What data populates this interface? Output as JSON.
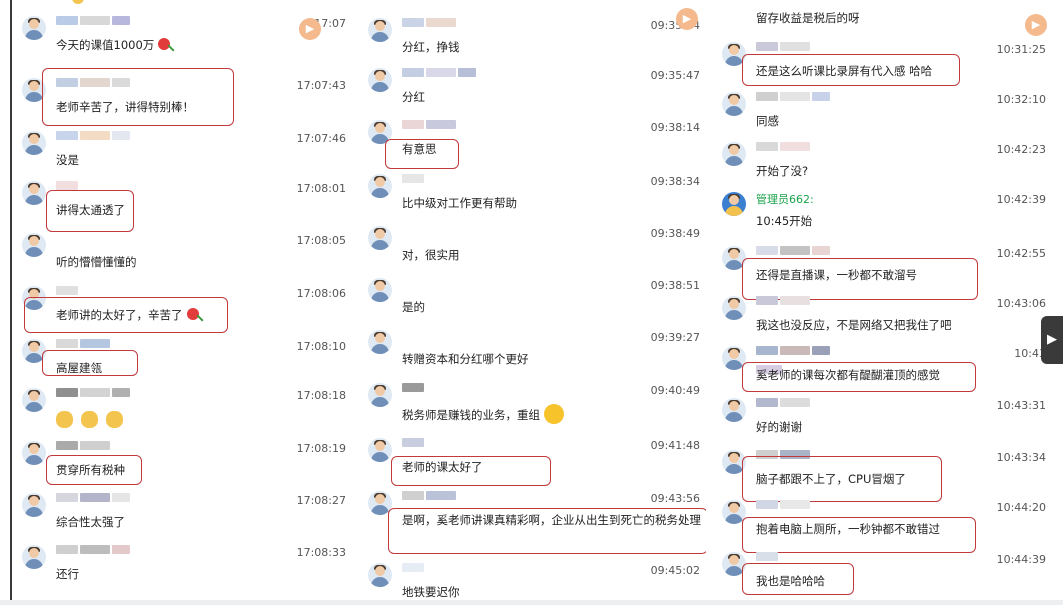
{
  "columns": [
    {
      "messages": [
        {
          "time": "17:07",
          "text": "今天的课值1000万",
          "emoji": "flower",
          "name_colors": [
            "#b9cbe6",
            "#d8d8d8",
            "#b7b7dd"
          ]
        },
        {
          "time": "17:07:43",
          "text": "老师辛苦了，讲得特别棒！",
          "boxed": true,
          "name_colors": [
            "#c2cfe3",
            "#e2d6cf",
            "#dadada"
          ]
        },
        {
          "time": "17:07:46",
          "text": "没是",
          "name_colors": [
            "#c8d4ec",
            "#f4dcc4",
            "#e3e8f0"
          ]
        },
        {
          "time": "17:08:01",
          "text": "讲得太通透了",
          "boxed": true,
          "name_colors": [
            "#f2dede"
          ]
        },
        {
          "time": "17:08:05",
          "text": "听的懵懵懂懂的",
          "name_colors": []
        },
        {
          "time": "17:08:06",
          "text": "老师讲的太好了，辛苦了",
          "emoji": "flower",
          "boxed": true,
          "name_colors": [
            "#e0e0e0"
          ]
        },
        {
          "time": "17:08:10",
          "text": "高屋建瓴",
          "boxed": true,
          "name_colors": [
            "#d9d9d9",
            "#b5c7e0"
          ]
        },
        {
          "time": "17:08:18",
          "text": "",
          "emoji": "claps",
          "name_colors": [
            "#8f8f8f",
            "#d3d3d3",
            "#b0b0b0"
          ]
        },
        {
          "time": "17:08:19",
          "text": "贯穿所有税种",
          "boxed": true,
          "name_colors": [
            "#aaaaaa",
            "#cfcfcf"
          ]
        },
        {
          "time": "17:08:27",
          "text": "综合性太强了",
          "name_colors": [
            "#d6d6de",
            "#b3b3c9",
            "#e5e5e5"
          ]
        },
        {
          "time": "17:08:33",
          "text": "还行",
          "name_colors": [
            "#cfcfcf",
            "#bdbdbd",
            "#e3c9c9"
          ]
        }
      ]
    },
    {
      "messages": [
        {
          "time": "09:35:44",
          "text": "分红，挣钱",
          "name_colors": [
            "#cbd3e6",
            "#e9d9cf"
          ]
        },
        {
          "time": "09:35:47",
          "text": "分红",
          "name_colors": [
            "#c4cee2",
            "#d8d8e8",
            "#b7bfd8"
          ]
        },
        {
          "time": "09:38:14",
          "text": "有意思",
          "boxed": true,
          "name_colors": [
            "#ead6d6",
            "#c9c9de"
          ]
        },
        {
          "time": "09:38:34",
          "text": "比中级对工作更有帮助",
          "name_colors": [
            "#e6e6e6"
          ]
        },
        {
          "time": "09:38:49",
          "text": "对，很实用",
          "name_colors": []
        },
        {
          "time": "09:38:51",
          "text": "是的",
          "name_colors": []
        },
        {
          "time": "09:39:27",
          "text": "转赠资本和分红哪个更好",
          "name_colors": []
        },
        {
          "time": "09:40:49",
          "text": "税务师是赚钱的业务，重组",
          "emoji": "smile",
          "name_colors": [
            "#9a9a9a"
          ]
        },
        {
          "time": "09:41:48",
          "text": "老师的课太好了",
          "boxed": true,
          "name_colors": [
            "#c8cde0"
          ]
        },
        {
          "time": "09:43:56",
          "text": "是啊，奚老师讲课真精彩啊，企业从出生到死亡的税务处理",
          "boxed": true,
          "name_colors": [
            "#cfcfcf",
            "#b9c2d9"
          ]
        },
        {
          "time": "09:45:02",
          "text": "地铁要迟你",
          "name_colors": [
            "#e6ecf4"
          ]
        }
      ]
    },
    {
      "messages": [
        {
          "time": "",
          "text": "留存收益是税后的呀",
          "name_colors": []
        },
        {
          "time": "10:31:25",
          "text": "还是这么听课比录屏有代入感 哈哈",
          "boxed": true,
          "name_colors": [
            "#c9c9d9",
            "#e0e0e0"
          ]
        },
        {
          "time": "10:32:10",
          "text": "同感",
          "name_colors": [
            "#cfcfcf",
            "#e4e4e4",
            "#c7d2ea"
          ]
        },
        {
          "time": "10:42:23",
          "text": "开始了没?",
          "name_colors": [
            "#d9d9d9",
            "#f1dede"
          ]
        },
        {
          "time": "10:42:39",
          "text": "10:45开始",
          "admin": true,
          "admin_name": "管理员662:",
          "name_colors": []
        },
        {
          "time": "10:42:55",
          "text": "还得是直播课，一秒都不敢溜号",
          "boxed": true,
          "name_colors": [
            "#d8dbe8",
            "#c3c3c3",
            "#e9d4d4"
          ]
        },
        {
          "time": "10:43:06",
          "text": "我这也没反应，不是网络又把我住了吧",
          "name_colors": [
            "#c8c8d8",
            "#e8e0e0"
          ]
        },
        {
          "time": "10:43",
          "text": "奚老师的课每次都有醍醐灌顶的感觉",
          "boxed": true,
          "name_colors": [
            "#a7b5cf",
            "#c9b9b9",
            "#9aa0b8",
            "#d7cde2"
          ]
        },
        {
          "time": "10:43:31",
          "text": "好的谢谢",
          "name_colors": [
            "#b2b8ce",
            "#dcdcdc"
          ]
        },
        {
          "time": "10:43:34",
          "text": "脑子都跟不上了，CPU冒烟了",
          "boxed": true,
          "name_colors": [
            "#cfcfcf",
            "#aab4c9"
          ]
        },
        {
          "time": "10:44:20",
          "text": "抱着电脑上厕所，一秒钟都不敢错过",
          "boxed": true,
          "name_colors": [
            "#d0d6e4",
            "#e8e8e8"
          ]
        },
        {
          "time": "10:44:39",
          "text": "我也是哈哈哈",
          "boxed": true,
          "name_colors": [
            "#d9dfe9"
          ]
        }
      ]
    }
  ],
  "icons": {
    "play": "play-badge-icon",
    "arrow": "collapse-arrow-icon"
  },
  "colors": {
    "highlight_box": "#c0393b",
    "admin_name": "#1aa34a"
  }
}
